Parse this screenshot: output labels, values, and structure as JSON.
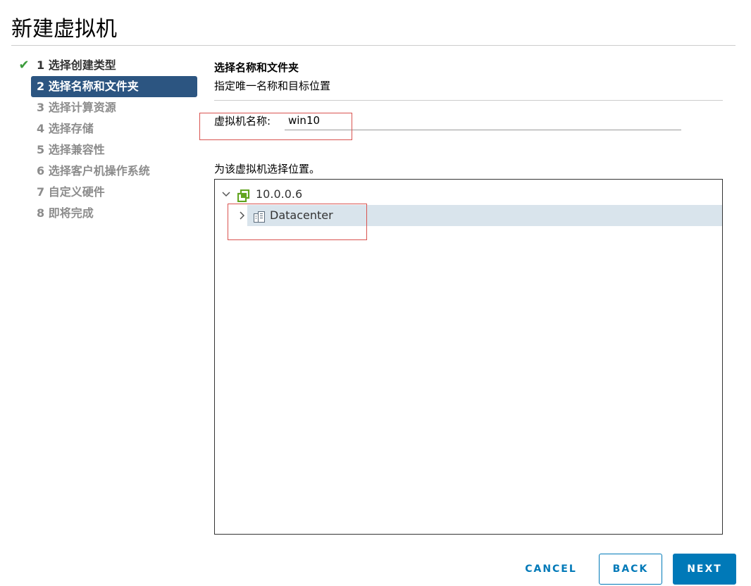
{
  "dialog": {
    "title": "新建虚拟机"
  },
  "steps": [
    {
      "label": "1 选择创建类型",
      "state": "done"
    },
    {
      "label": "2 选择名称和文件夹",
      "state": "active"
    },
    {
      "label": "3 选择计算资源",
      "state": "pending"
    },
    {
      "label": "4 选择存储",
      "state": "pending"
    },
    {
      "label": "5 选择兼容性",
      "state": "pending"
    },
    {
      "label": "6 选择客户机操作系统",
      "state": "pending"
    },
    {
      "label": "7 自定义硬件",
      "state": "pending"
    },
    {
      "label": "8 即将完成",
      "state": "pending"
    }
  ],
  "main": {
    "section_title": "选择名称和文件夹",
    "section_subtitle": "指定唯一名称和目标位置",
    "vm_name_label": "虚拟机名称:",
    "vm_name_value": "win10",
    "location_label": "为该虚拟机选择位置。",
    "tree": {
      "root": {
        "label": "10.0.0.6",
        "icon": "vcenter-icon",
        "expanded": true
      },
      "child": {
        "label": "Datacenter",
        "icon": "datacenter-icon",
        "expanded": false,
        "selected": true
      }
    }
  },
  "footer": {
    "cancel_label": "CANCEL",
    "back_label": "BACK",
    "next_label": "NEXT"
  },
  "colors": {
    "accent": "#0079b8",
    "active_step": "#2c5581",
    "check_green": "#3c9c3c",
    "selected_row": "#d9e4ec",
    "highlight_box": "#d9534f"
  }
}
